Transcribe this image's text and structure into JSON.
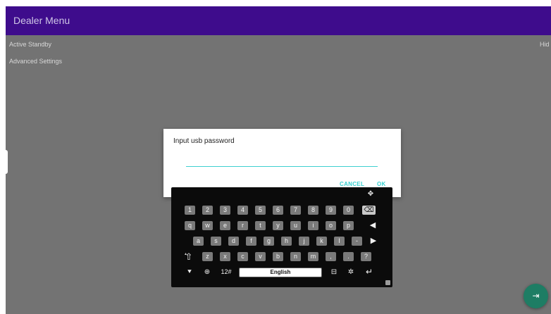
{
  "app": {
    "title": "Dealer Menu",
    "items": [
      {
        "label": "Active Standby",
        "value": "Hid"
      },
      {
        "label": "Advanced Settings"
      }
    ]
  },
  "dialog": {
    "title": "Input usb password",
    "input_value": "",
    "cancel_label": "CANCEL",
    "ok_label": "OK",
    "accent_color": "#38d0d0"
  },
  "keyboard": {
    "row_numbers": [
      "1",
      "2",
      "3",
      "4",
      "5",
      "6",
      "7",
      "8",
      "9",
      "0"
    ],
    "row_top": [
      "q",
      "w",
      "e",
      "r",
      "t",
      "y",
      "u",
      "i",
      "o",
      "p"
    ],
    "row_home": [
      "a",
      "s",
      "d",
      "f",
      "g",
      "h",
      "j",
      "k",
      "l",
      "-"
    ],
    "row_bottom": [
      "z",
      "x",
      "c",
      "v",
      "b",
      "n",
      "m",
      ",",
      ".",
      "?"
    ],
    "mode_label": "12#",
    "space_label": "English",
    "icons": {
      "move": "move-handle-icon",
      "backspace": "backspace-icon",
      "left": "arrow-left-icon",
      "right": "arrow-right-icon",
      "shift": "shift-icon",
      "hide": "hide-keyboard-icon",
      "globe": "globe-icon",
      "width": "width-toggle-icon",
      "settings": "settings-icon",
      "enter": "enter-icon",
      "resize": "resize-icon"
    }
  },
  "fab": {
    "icon": "exit-icon"
  },
  "colors": {
    "appbar": "#3e0c8c",
    "scrim": "#737373",
    "fab": "#1e7d64"
  }
}
